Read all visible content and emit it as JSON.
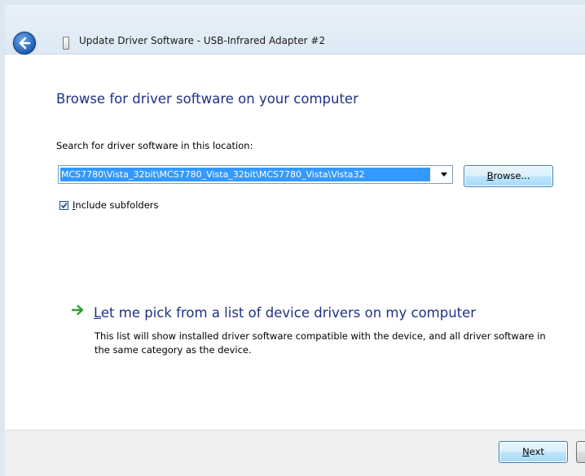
{
  "window": {
    "title": "Update Driver Software - USB-Infrared Adapter #2",
    "back_icon": "back-arrow-icon",
    "device_icon": "usb-device-icon"
  },
  "main": {
    "heading": "Browse for driver software on your computer",
    "search_label": "Search for driver software in this location:",
    "path_value": "MCS7780\\Vista_32bit\\MCS7780_Vista_32bit\\MCS7780_Vista\\Vista32",
    "browse_mnemonic": "B",
    "browse_rest": "rowse...",
    "include_checked": true,
    "include_mnemonic": "I",
    "include_rest": "nclude subfolders"
  },
  "pick": {
    "icon": "green-arrow-icon",
    "title_mnemonic": "L",
    "title_rest": "et me pick from a list of device drivers on my computer",
    "description": "This list will show installed driver software compatible with the device, and all driver software in the same category as the device."
  },
  "footer": {
    "next_mnemonic": "N",
    "next_rest": "ext"
  },
  "colors": {
    "heading": "#1e3287",
    "selection": "#3399ff",
    "arrow": "#2e9e2e"
  }
}
